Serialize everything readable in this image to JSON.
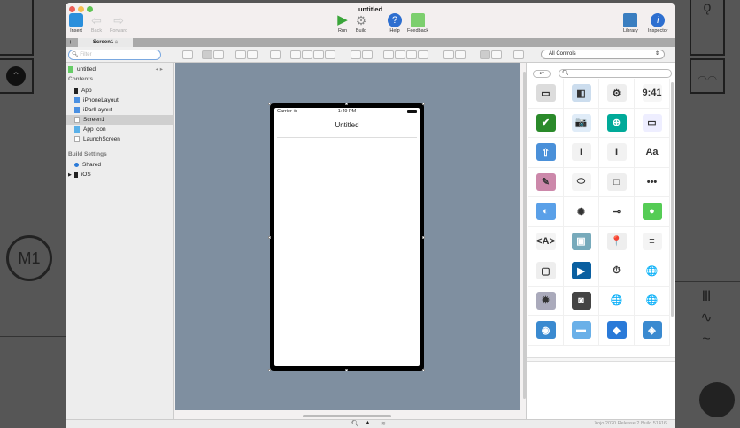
{
  "window": {
    "title": "untitled"
  },
  "toolbar": {
    "insert": "Insert",
    "back": "Back",
    "forward": "Forward",
    "run": "Run",
    "build": "Build",
    "help": "Help",
    "feedback": "Feedback",
    "library": "Library",
    "inspector": "Inspector"
  },
  "tabs": [
    {
      "label": "Screen1"
    }
  ],
  "navigator": {
    "filter_placeholder": "Filter",
    "project": "untitled",
    "contents_header": "Contents",
    "items": [
      {
        "label": "App"
      },
      {
        "label": "iPhoneLayout"
      },
      {
        "label": "iPadLayout"
      },
      {
        "label": "Screen1"
      },
      {
        "label": "App Icon"
      },
      {
        "label": "LaunchScreen"
      }
    ],
    "build_header": "Build Settings",
    "build_items": [
      {
        "label": "Shared"
      },
      {
        "label": "iOS"
      }
    ]
  },
  "phone": {
    "carrier": "Carrier",
    "time": "1:49 PM",
    "nav_title": "Untitled"
  },
  "library": {
    "filter": "All Controls",
    "search_placeholder": "",
    "items": [
      {
        "name": "button",
        "glyph": "▭",
        "color": "#dcdcdc"
      },
      {
        "name": "segmented",
        "glyph": "◧",
        "color": "#cde"
      },
      {
        "name": "gear",
        "glyph": "⚙",
        "color": "#eee"
      },
      {
        "name": "label",
        "glyph": "9:41",
        "color": "#f6f6f6"
      },
      {
        "name": "checkbox",
        "glyph": "✔",
        "color": "#2a8a2a"
      },
      {
        "name": "camera",
        "glyph": "📷",
        "color": "#e0ecf8"
      },
      {
        "name": "location",
        "glyph": "⊕",
        "color": "#0a9"
      },
      {
        "name": "text-field",
        "glyph": "▭",
        "color": "#eef"
      },
      {
        "name": "share",
        "glyph": "⇧",
        "color": "#4a90d9"
      },
      {
        "name": "text-input",
        "glyph": "I",
        "color": "#f2f2f2"
      },
      {
        "name": "text-area",
        "glyph": "I",
        "color": "#f2f2f2"
      },
      {
        "name": "font",
        "glyph": "Aa",
        "color": "#fff"
      },
      {
        "name": "canvas",
        "glyph": "✎",
        "color": "#c8a"
      },
      {
        "name": "oval",
        "glyph": "⬭",
        "color": "#f4f4f4"
      },
      {
        "name": "rectangle",
        "glyph": "□",
        "color": "#eee"
      },
      {
        "name": "page-control",
        "glyph": "•••",
        "color": "#fff"
      },
      {
        "name": "switch-off",
        "glyph": "◐",
        "color": "#5aa0e8"
      },
      {
        "name": "progress-wheel",
        "glyph": "✺",
        "color": "#fff"
      },
      {
        "name": "slider",
        "glyph": "⊸",
        "color": "#fff"
      },
      {
        "name": "switch",
        "glyph": "●",
        "color": "#5c5"
      },
      {
        "name": "html-viewer",
        "glyph": "<A>",
        "color": "#f4f4f4"
      },
      {
        "name": "image-view",
        "glyph": "▣",
        "color": "#7ab"
      },
      {
        "name": "map",
        "glyph": "📍",
        "color": "#eee"
      },
      {
        "name": "table",
        "glyph": "≡",
        "color": "#f4f4f4"
      },
      {
        "name": "container",
        "glyph": "▢",
        "color": "#eee"
      },
      {
        "name": "movie-player",
        "glyph": "▶",
        "color": "#0a5fa0"
      },
      {
        "name": "timer",
        "glyph": "⏱",
        "color": "#fff"
      },
      {
        "name": "globe-server",
        "glyph": "🌐",
        "color": "#fff"
      },
      {
        "name": "thread",
        "glyph": "✹",
        "color": "#aab"
      },
      {
        "name": "spool",
        "glyph": "◙",
        "color": "#444"
      },
      {
        "name": "url-connection",
        "glyph": "🌐",
        "color": "#fff"
      },
      {
        "name": "tcp-socket",
        "glyph": "🌐",
        "color": "#fff"
      },
      {
        "name": "web",
        "glyph": "◉",
        "color": "#3a8ad0"
      },
      {
        "name": "folder",
        "glyph": "▬",
        "color": "#6ab0e8"
      },
      {
        "name": "cube",
        "glyph": "◆",
        "color": "#2a7ad8"
      },
      {
        "name": "layers",
        "glyph": "◈",
        "color": "#3a8ad0"
      }
    ]
  },
  "status": {
    "build": "Xojo 2020 Release 2 Build 51416"
  }
}
